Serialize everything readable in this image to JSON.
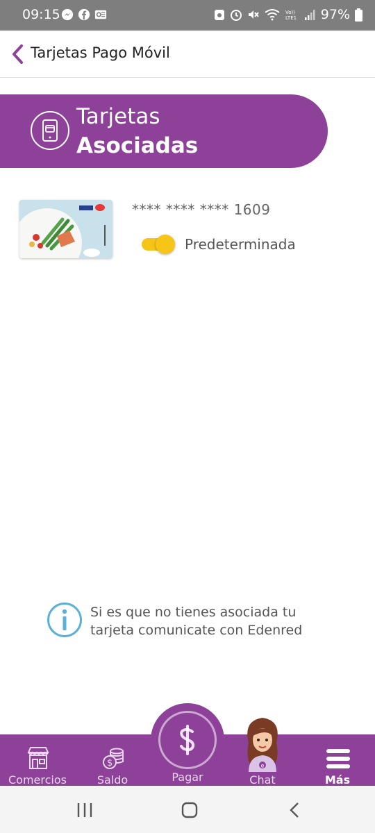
{
  "status_bar": {
    "time": "09:15",
    "battery": "97%",
    "left_icons": [
      "messenger-icon",
      "facebook-icon",
      "outlook-icon"
    ],
    "right_icons": [
      "recorder-icon",
      "alarm-icon",
      "mute-icon",
      "wifi-icon",
      "volte-icon",
      "signal-icon",
      "battery-icon"
    ]
  },
  "app_bar": {
    "title": "Tarjetas Pago Móvil",
    "back_icon": "chevron-left-icon"
  },
  "banner": {
    "line1": "Tarjetas",
    "line2": "Asociadas",
    "icon": "phone-card-icon"
  },
  "card": {
    "masked_number": "**** **** **** 1609",
    "default_label": "Predeterminada",
    "is_default": true,
    "thumbnail": "ticket-restaurant-card-image"
  },
  "info": {
    "text": "Si es que no tienes asociada tu tarjeta comunicate con Edenred",
    "icon": "info-icon"
  },
  "bottom_nav": {
    "items": [
      {
        "label": "Comercios",
        "icon": "store-icon"
      },
      {
        "label": "Saldo",
        "icon": "coins-icon"
      },
      {
        "label": "Pagar",
        "icon": "dollar-icon"
      },
      {
        "label": "Chat",
        "icon": "avatar-icon"
      },
      {
        "label": "Más",
        "icon": "menu-icon"
      }
    ],
    "active": "Más"
  },
  "colors": {
    "brand_purple": "#8d4199",
    "toggle_yellow": "#f5c518",
    "info_blue": "#5bb0d8"
  }
}
